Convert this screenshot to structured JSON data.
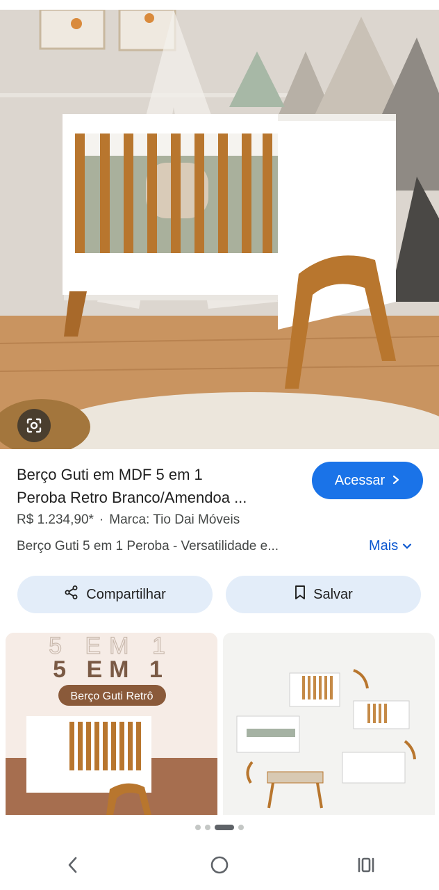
{
  "product": {
    "title_line1": "Berço Guti em MDF 5 em 1",
    "title_line2": "Peroba Retro Branco/Amendoa ...",
    "price": "R$ 1.234,90*",
    "separator": "·",
    "brand": "Marca: Tio Dai Móveis",
    "description": "Berço Guti 5 em 1 Peroba - Versatilidade e..."
  },
  "actions": {
    "access_label": "Acessar",
    "more_label": "Mais",
    "share_label": "Compartilhar",
    "save_label": "Salvar"
  },
  "thumbnails": {
    "left_outline_text": "5 EM 1",
    "left_heading": "5 EM 1",
    "left_badge": "Berço Guti Retrô"
  },
  "carousel": {
    "count": 4,
    "active_index": 2
  },
  "icons": {
    "lens": "google-lens-icon",
    "share": "share-icon",
    "save": "bookmark-icon",
    "back": "back-chevron-icon",
    "home": "home-circle-icon",
    "recents": "recents-icon"
  },
  "colors": {
    "accent": "#1a73e8",
    "link": "#0b57d0",
    "pill_bg": "#e3edf9",
    "wood": "#b8762e"
  }
}
